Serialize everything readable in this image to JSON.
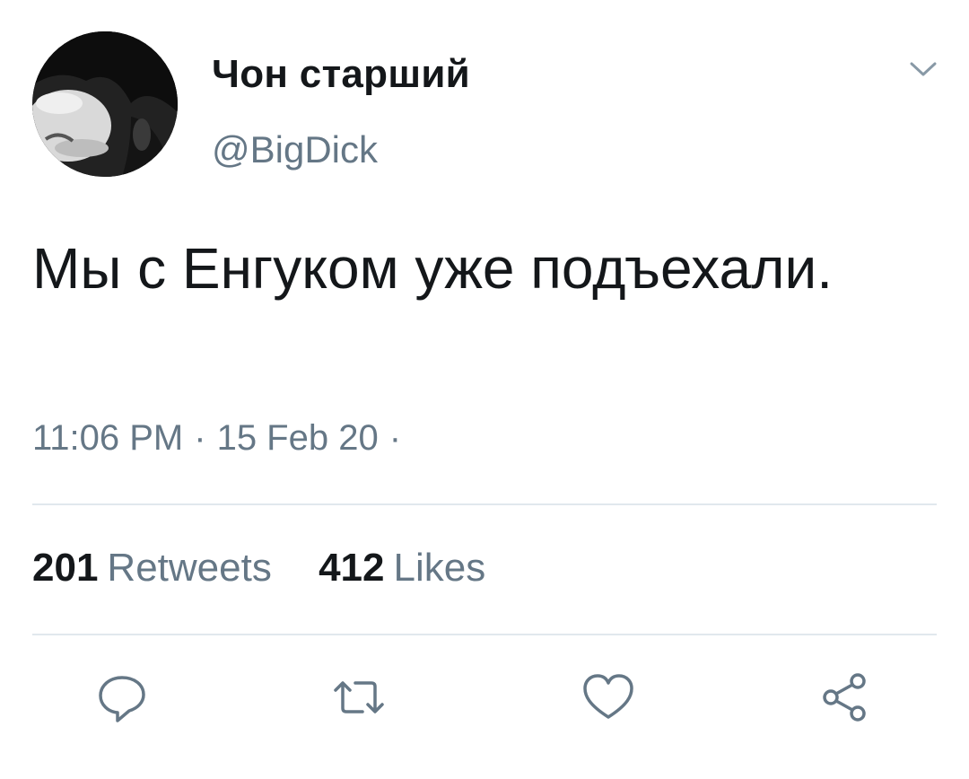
{
  "user": {
    "display_name": "Чон старший",
    "handle": "@BigDick",
    "avatar_icon": "avatar-photo"
  },
  "tweet": {
    "text": "Мы с Енгуком уже подъехали.",
    "time": "11:06 PM",
    "date": "15 Feb 20",
    "trailing_separator": "·"
  },
  "stats": {
    "retweets_count": "201",
    "retweets_label": "Retweets",
    "likes_count": "412",
    "likes_label": "Likes"
  },
  "actions": {
    "reply_icon": "reply-icon",
    "retweet_icon": "retweet-icon",
    "like_icon": "heart-icon",
    "share_icon": "share-icon"
  },
  "colors": {
    "text": "#14171a",
    "secondary": "#657786",
    "divider": "#e1e8ed"
  }
}
